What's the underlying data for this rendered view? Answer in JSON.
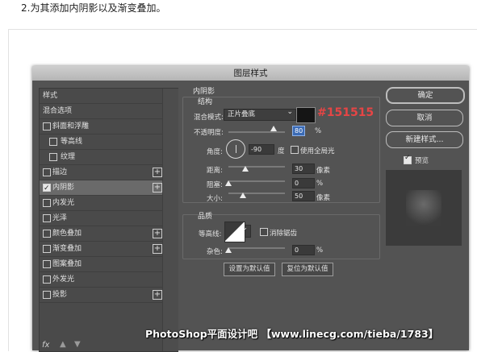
{
  "caption": "2.为其添加内阴影以及渐变叠加。",
  "dialog": {
    "title": "图层样式",
    "style_list": [
      {
        "label": "样式",
        "checkbox": false,
        "checked": false,
        "plus": false,
        "indent": false,
        "selected": false
      },
      {
        "label": "混合选项",
        "checkbox": false,
        "checked": false,
        "plus": false,
        "indent": false,
        "selected": false
      },
      {
        "label": "斜面和浮雕",
        "checkbox": true,
        "checked": false,
        "plus": false,
        "indent": false,
        "selected": false
      },
      {
        "label": "等高线",
        "checkbox": true,
        "checked": false,
        "plus": false,
        "indent": true,
        "selected": false
      },
      {
        "label": "纹理",
        "checkbox": true,
        "checked": false,
        "plus": false,
        "indent": true,
        "selected": false
      },
      {
        "label": "描边",
        "checkbox": true,
        "checked": false,
        "plus": true,
        "indent": false,
        "selected": false
      },
      {
        "label": "内阴影",
        "checkbox": true,
        "checked": true,
        "plus": true,
        "indent": false,
        "selected": true
      },
      {
        "label": "内发光",
        "checkbox": true,
        "checked": false,
        "plus": false,
        "indent": false,
        "selected": false
      },
      {
        "label": "光泽",
        "checkbox": true,
        "checked": false,
        "plus": false,
        "indent": false,
        "selected": false
      },
      {
        "label": "颜色叠加",
        "checkbox": true,
        "checked": false,
        "plus": true,
        "indent": false,
        "selected": false
      },
      {
        "label": "渐变叠加",
        "checkbox": true,
        "checked": false,
        "plus": true,
        "indent": false,
        "selected": false
      },
      {
        "label": "图案叠加",
        "checkbox": true,
        "checked": false,
        "plus": false,
        "indent": false,
        "selected": false
      },
      {
        "label": "外发光",
        "checkbox": true,
        "checked": false,
        "plus": false,
        "indent": false,
        "selected": false
      },
      {
        "label": "投影",
        "checkbox": true,
        "checked": false,
        "plus": true,
        "indent": false,
        "selected": false
      }
    ],
    "fx_label": "fx",
    "inner_shadow": {
      "title": "内阴影",
      "structure": {
        "title": "结构",
        "blend_mode_label": "混合模式:",
        "blend_mode_value": "正片叠底",
        "shadow_color": "#151515",
        "color_annotation": "#151515",
        "opacity_label": "不透明度:",
        "opacity_value": "80",
        "opacity_unit": "%",
        "opacity_level": 80,
        "angle_label": "角度:",
        "angle_value": "-90",
        "angle_unit": "度",
        "global_light_label": "使用全局光",
        "global_light_checked": false,
        "distance_label": "距离:",
        "distance_value": "30",
        "distance_unit": "像素",
        "choke_label": "阻塞:",
        "choke_value": "0",
        "choke_unit": "%",
        "size_label": "大小:",
        "size_value": "50",
        "size_unit": "像素"
      },
      "quality": {
        "title": "品质",
        "contour_label": "等高线:",
        "anti_alias_label": "消除锯齿",
        "anti_alias_checked": false,
        "noise_label": "杂色:",
        "noise_value": "0",
        "noise_unit": "%"
      },
      "set_default_label": "设置为默认值",
      "reset_default_label": "复位为默认值"
    },
    "buttons": {
      "ok": "确定",
      "cancel": "取消",
      "new_style": "新建样式...",
      "preview_label": "预览",
      "preview_checked": true
    }
  },
  "watermark": "PhotoShop平面设计吧 【www.linecg.com/tieba/1783】"
}
